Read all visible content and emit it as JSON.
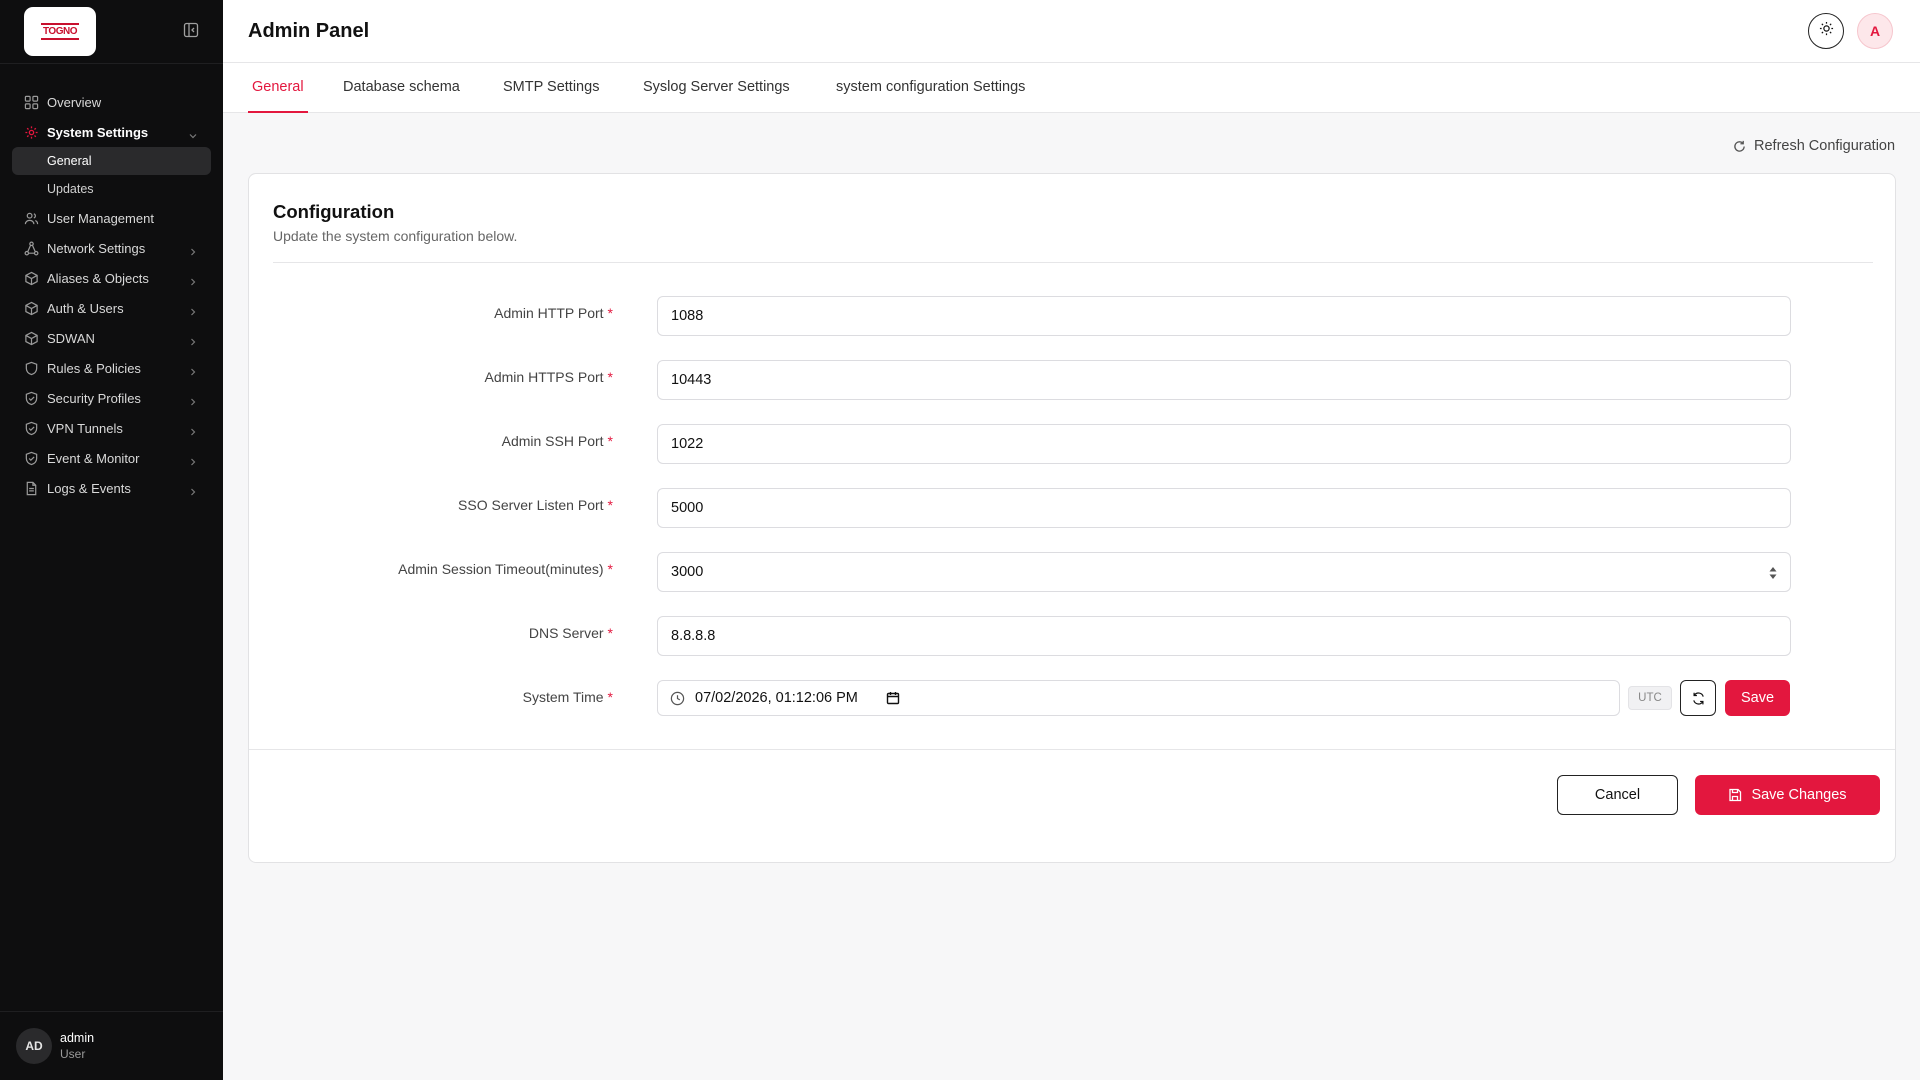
{
  "brand": {
    "logo_text": "TOGNO",
    "accent": "#e3173e"
  },
  "sidebar": {
    "items": [
      {
        "label": "Overview",
        "icon": "grid-icon"
      },
      {
        "label": "System Settings",
        "icon": "gear-icon",
        "expanded": true,
        "children": [
          {
            "label": "General",
            "active": true
          },
          {
            "label": "Updates"
          }
        ]
      },
      {
        "label": "User Management",
        "icon": "users-icon"
      },
      {
        "label": "Network Settings",
        "icon": "network-icon"
      },
      {
        "label": "Aliases & Objects",
        "icon": "cube-icon"
      },
      {
        "label": "Auth & Users",
        "icon": "cube-icon"
      },
      {
        "label": "SDWAN",
        "icon": "cube-icon"
      },
      {
        "label": "Rules & Policies",
        "icon": "shield-icon"
      },
      {
        "label": "Security Profiles",
        "icon": "shield-check-icon"
      },
      {
        "label": "VPN Tunnels",
        "icon": "shield-check-icon"
      },
      {
        "label": "Event & Monitor",
        "icon": "shield-check-icon"
      },
      {
        "label": "Logs & Events",
        "icon": "file-icon"
      }
    ],
    "user": {
      "initials": "AD",
      "name": "admin",
      "role": "User"
    }
  },
  "header": {
    "title": "Admin Panel",
    "avatar_initial": "A"
  },
  "tabs": [
    {
      "label": "General",
      "active": true
    },
    {
      "label": "Database schema"
    },
    {
      "label": "SMTP Settings"
    },
    {
      "label": "Syslog Server Settings"
    },
    {
      "label": "system configuration Settings"
    }
  ],
  "refresh_label": "Refresh Configuration",
  "config": {
    "title": "Configuration",
    "subtitle": "Update the system configuration below.",
    "fields": [
      {
        "label": "Admin HTTP Port",
        "required": "*",
        "value": "1088"
      },
      {
        "label": "Admin HTTPS Port",
        "required": "*",
        "value": "10443"
      },
      {
        "label": "Admin SSH Port",
        "required": "*",
        "value": "1022"
      },
      {
        "label": "SSO Server Listen Port",
        "required": "*",
        "value": "5000"
      },
      {
        "label": "Admin Session Timeout(minutes)",
        "required": "*",
        "value": "3000"
      },
      {
        "label": "DNS Server",
        "required": "*",
        "value": "8.8.8.8"
      }
    ],
    "system_time": {
      "label": "System Time",
      "required": "*",
      "value": "07/02/2026, 01:12:06 PM",
      "tz": "UTC",
      "save_label": "Save"
    },
    "cancel_label": "Cancel",
    "save_changes_label": "Save Changes"
  }
}
